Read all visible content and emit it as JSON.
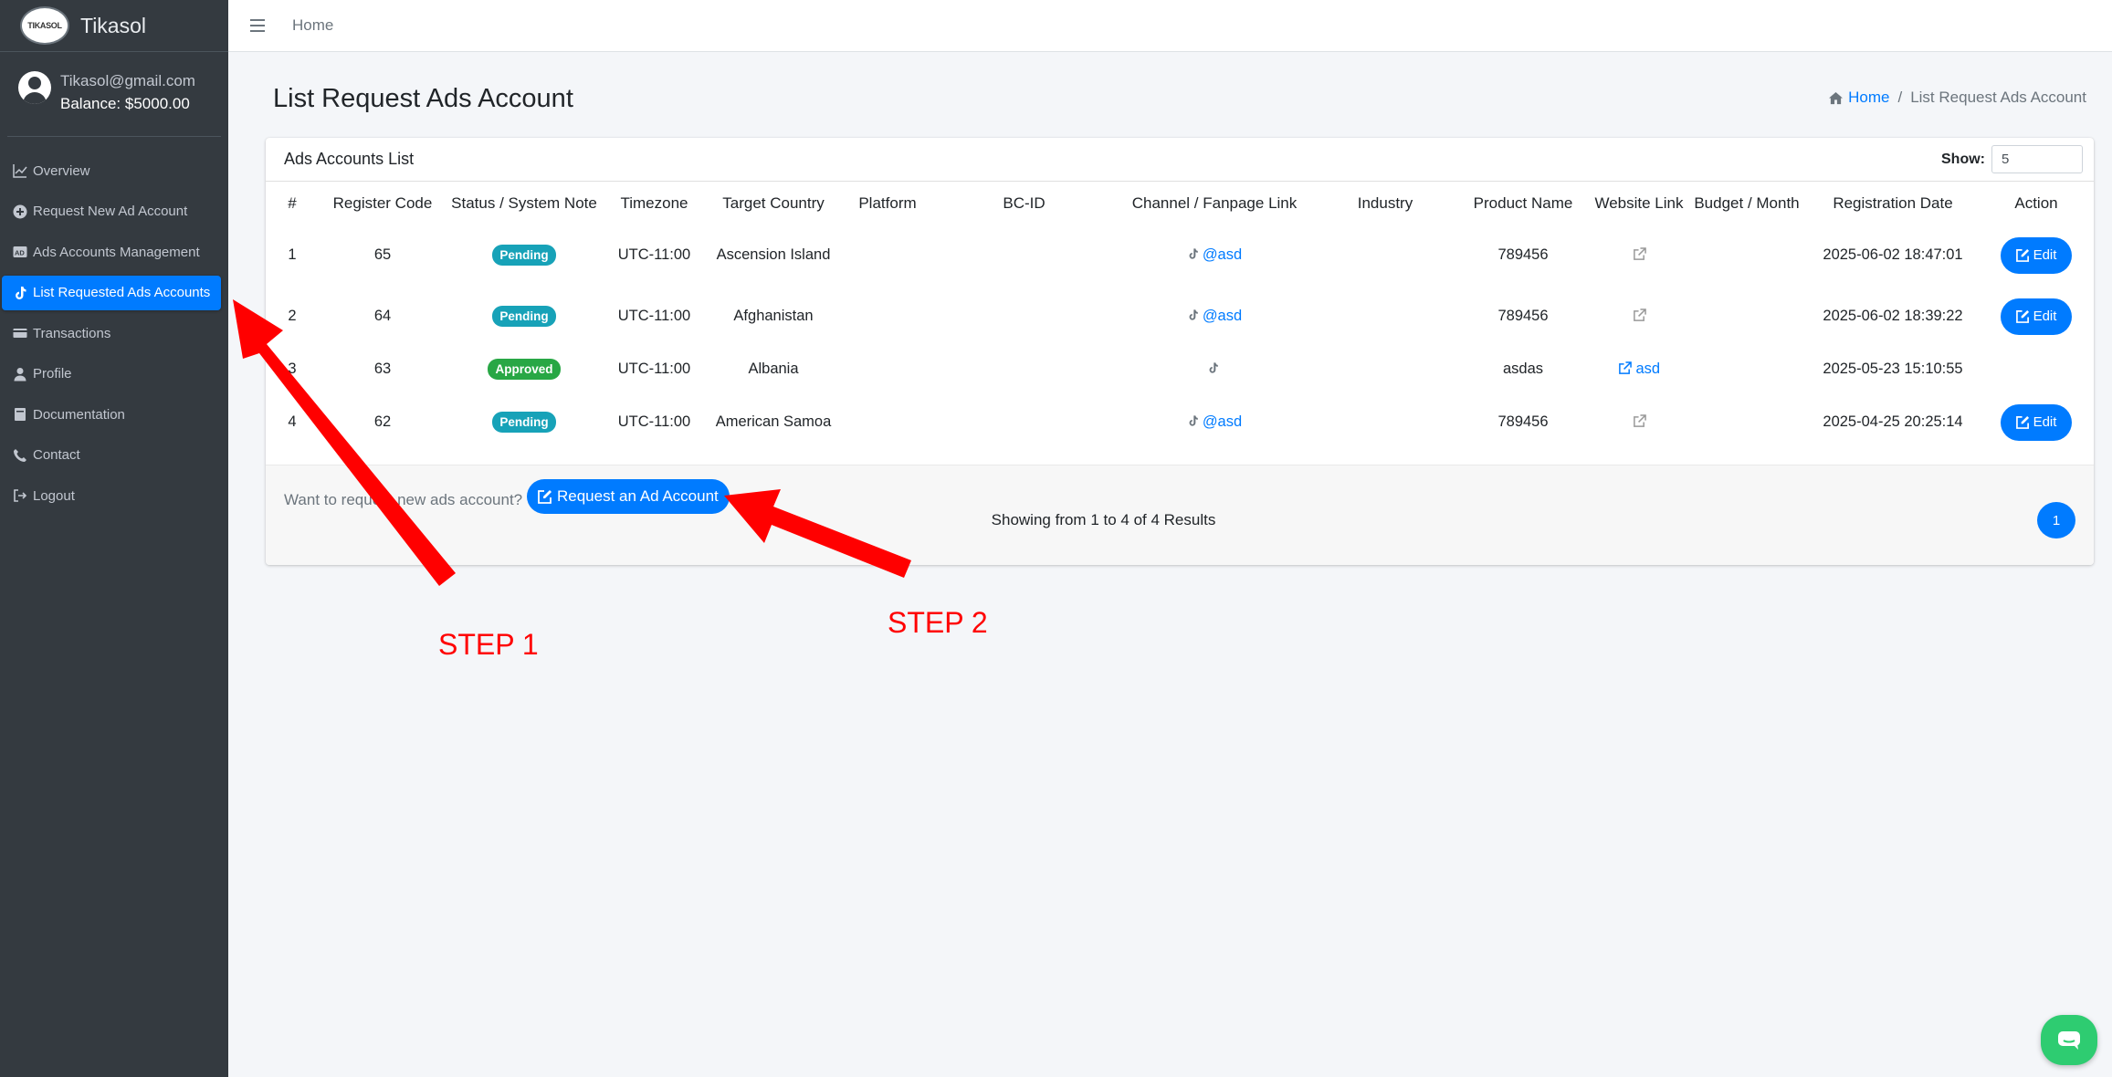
{
  "brand": {
    "logo_text": "TIKASOL",
    "name": "Tikasol"
  },
  "user": {
    "email": "Tikasol@gmail.com",
    "balance": "Balance: $5000.00"
  },
  "sidebar": {
    "items": [
      {
        "label": "Overview",
        "icon": "chart-line-icon"
      },
      {
        "label": "Request New Ad Account",
        "icon": "plus-circle-icon"
      },
      {
        "label": "Ads Accounts Management",
        "icon": "ad-icon"
      },
      {
        "label": "List Requested Ads Accounts",
        "icon": "tiktok-icon",
        "active": true
      },
      {
        "label": "Transactions",
        "icon": "money-bill-icon"
      },
      {
        "label": "Profile",
        "icon": "user-icon"
      },
      {
        "label": "Documentation",
        "icon": "book-icon"
      },
      {
        "label": "Contact",
        "icon": "phone-icon"
      },
      {
        "label": "Logout",
        "icon": "sign-out-icon"
      }
    ]
  },
  "topbar": {
    "home": "Home"
  },
  "page": {
    "title": "List Request Ads Account",
    "breadcrumb_home": "Home",
    "breadcrumb_sep": "/",
    "breadcrumb_current": "List Request Ads Account"
  },
  "card": {
    "title": "Ads Accounts List",
    "show_label": "Show:",
    "show_value": "5"
  },
  "table": {
    "headers": [
      "#",
      "Register Code",
      "Status / System Note",
      "Timezone",
      "Target Country",
      "Platform",
      "BC-ID",
      "Channel / Fanpage Link",
      "Industry",
      "Product Name",
      "Website Link",
      "Budget / Month",
      "Registration Date",
      "Action"
    ],
    "rows": [
      {
        "num": "1",
        "code": "65",
        "status": "Pending",
        "timezone": "UTC-11:00",
        "country": "Ascension Island",
        "platform": "",
        "bcid": "",
        "channel": "@asd",
        "industry": "",
        "product": "789456",
        "website": "",
        "budget": "",
        "date": "2025-06-02 18:47:01",
        "action": "Edit"
      },
      {
        "num": "2",
        "code": "64",
        "status": "Pending",
        "timezone": "UTC-11:00",
        "country": "Afghanistan",
        "platform": "",
        "bcid": "",
        "channel": "@asd",
        "industry": "",
        "product": "789456",
        "website": "",
        "budget": "",
        "date": "2025-06-02 18:39:22",
        "action": "Edit"
      },
      {
        "num": "3",
        "code": "63",
        "status": "Approved",
        "timezone": "UTC-11:00",
        "country": "Albania",
        "platform": "",
        "bcid": "",
        "channel": "",
        "industry": "",
        "product": "asdas",
        "website": "asd",
        "budget": "",
        "date": "2025-05-23 15:10:55",
        "action": ""
      },
      {
        "num": "4",
        "code": "62",
        "status": "Pending",
        "timezone": "UTC-11:00",
        "country": "American Samoa",
        "platform": "",
        "bcid": "",
        "channel": "@asd",
        "industry": "",
        "product": "789456",
        "website": "",
        "budget": "",
        "date": "2025-04-25 20:25:14",
        "action": "Edit"
      }
    ]
  },
  "footer": {
    "want_text": "Want to request new ads account?",
    "request_button": "Request an Ad Account",
    "showing": "Showing from 1 to 4 of 4 Results",
    "page": "1"
  },
  "annotations": {
    "step1": "STEP 1",
    "step2": "STEP 2",
    "color": "#ff0000"
  },
  "colors": {
    "primary": "#007bff",
    "sidebar_bg": "#343a40",
    "pending": "#17a2b8",
    "approved": "#28a745",
    "chat": "#2ecc71"
  }
}
